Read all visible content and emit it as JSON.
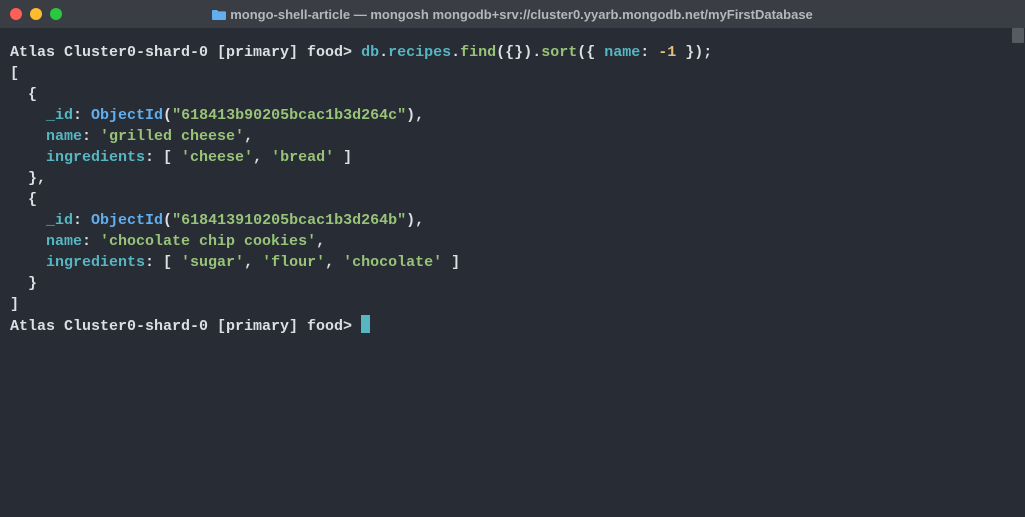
{
  "window": {
    "title": "mongo-shell-article — mongosh mongodb+srv://cluster0.yyarb.mongodb.net/myFirstDatabase"
  },
  "session": {
    "prompt_prefix": "Atlas Cluster0-shard-0 [primary] food>",
    "command": {
      "db": "db",
      "collection": "recipes",
      "find_call": "find",
      "find_arg": "{}",
      "sort_call": "sort",
      "sort_open": "({ ",
      "sort_field": "name",
      "sort_sep": ": ",
      "sort_value": "-1",
      "sort_close": " });"
    },
    "output": {
      "open": "[",
      "close": "]",
      "records": [
        {
          "open": "  {",
          "id_key": "    _id",
          "id_fn": "ObjectId",
          "id_val": "\"618413b90205bcac1b3d264c\"",
          "name_key": "    name",
          "name_val": "'grilled cheese'",
          "ing_key": "    ingredients",
          "ing_vals": [
            "'cheese'",
            "'bread'"
          ],
          "close": "  },"
        },
        {
          "open": "  {",
          "id_key": "    _id",
          "id_fn": "ObjectId",
          "id_val": "\"618413910205bcac1b3d264b\"",
          "name_key": "    name",
          "name_val": "'chocolate chip cookies'",
          "ing_key": "    ingredients",
          "ing_vals": [
            "'sugar'",
            "'flour'",
            "'chocolate'"
          ],
          "close": "  }"
        }
      ]
    }
  }
}
